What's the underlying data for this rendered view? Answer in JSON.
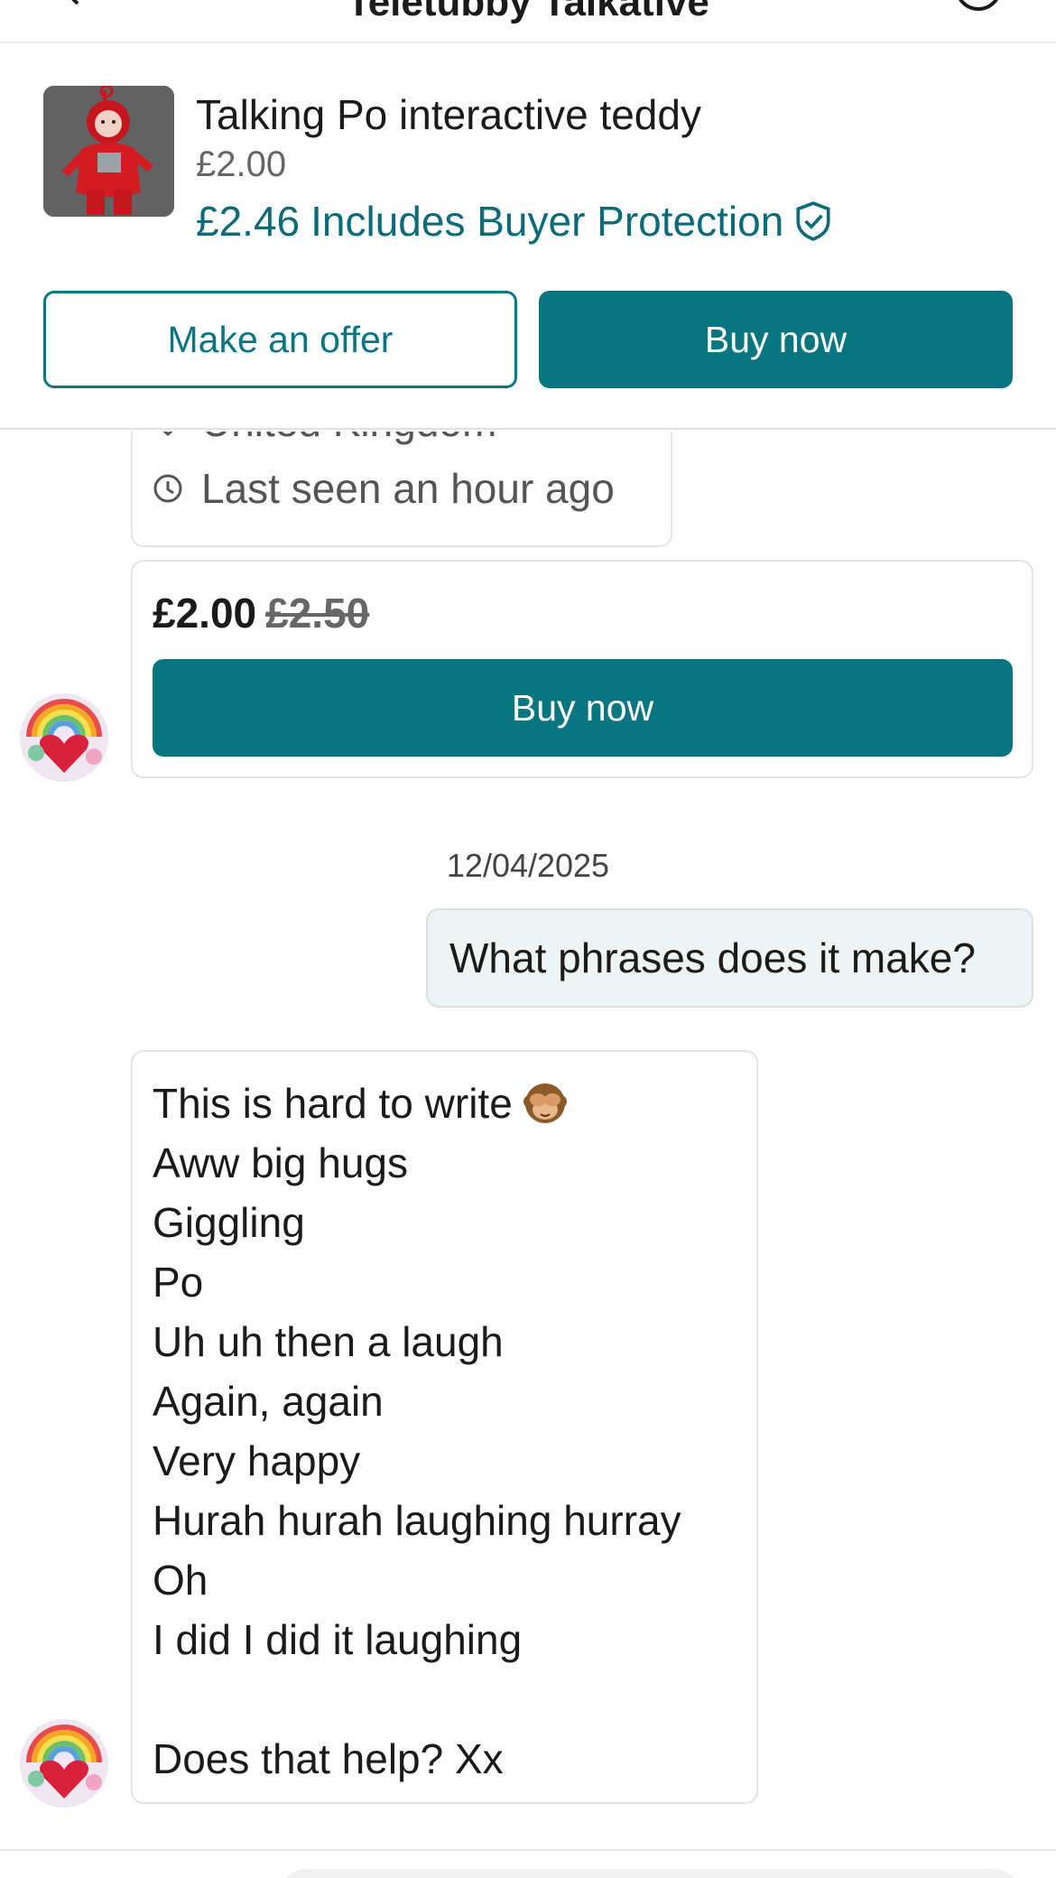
{
  "header": {
    "title": "Teletubby Talkative",
    "back_icon": "arrow-left-icon",
    "info_icon": "info-icon"
  },
  "item": {
    "title": "Talking Po interactive teddy",
    "price": "£2.00",
    "total_price": "£2.46",
    "protection_text": "Includes Buyer Protection",
    "shield_icon": "shield-check-icon",
    "make_offer_label": "Make an offer",
    "buy_now_label": "Buy now"
  },
  "seller_card": {
    "location": "United Kingdom",
    "last_seen": "Last seen an hour ago",
    "location_icon": "location-pin-icon",
    "clock_icon": "clock-icon"
  },
  "offer_card": {
    "new_price": "£2.00",
    "old_price": "£2.50",
    "buy_now_label": "Buy now"
  },
  "conversation": {
    "date": "12/04/2025",
    "outgoing_message": "What phrases does it make?",
    "incoming_lines": [
      "This is hard to write",
      "Aww big hugs",
      "Giggling",
      "Po",
      "Uh uh then a laugh",
      "Again, again",
      "Very happy",
      "Hurah hurah laughing hurray",
      "Oh",
      "I did I did it laughing",
      "",
      "Does that help? Xx"
    ],
    "emoji": "see-no-evil-monkey"
  },
  "colors": {
    "accent": "#077680",
    "accent_text": "#0b6b78",
    "outgoing_bubble": "#eef3f3"
  }
}
